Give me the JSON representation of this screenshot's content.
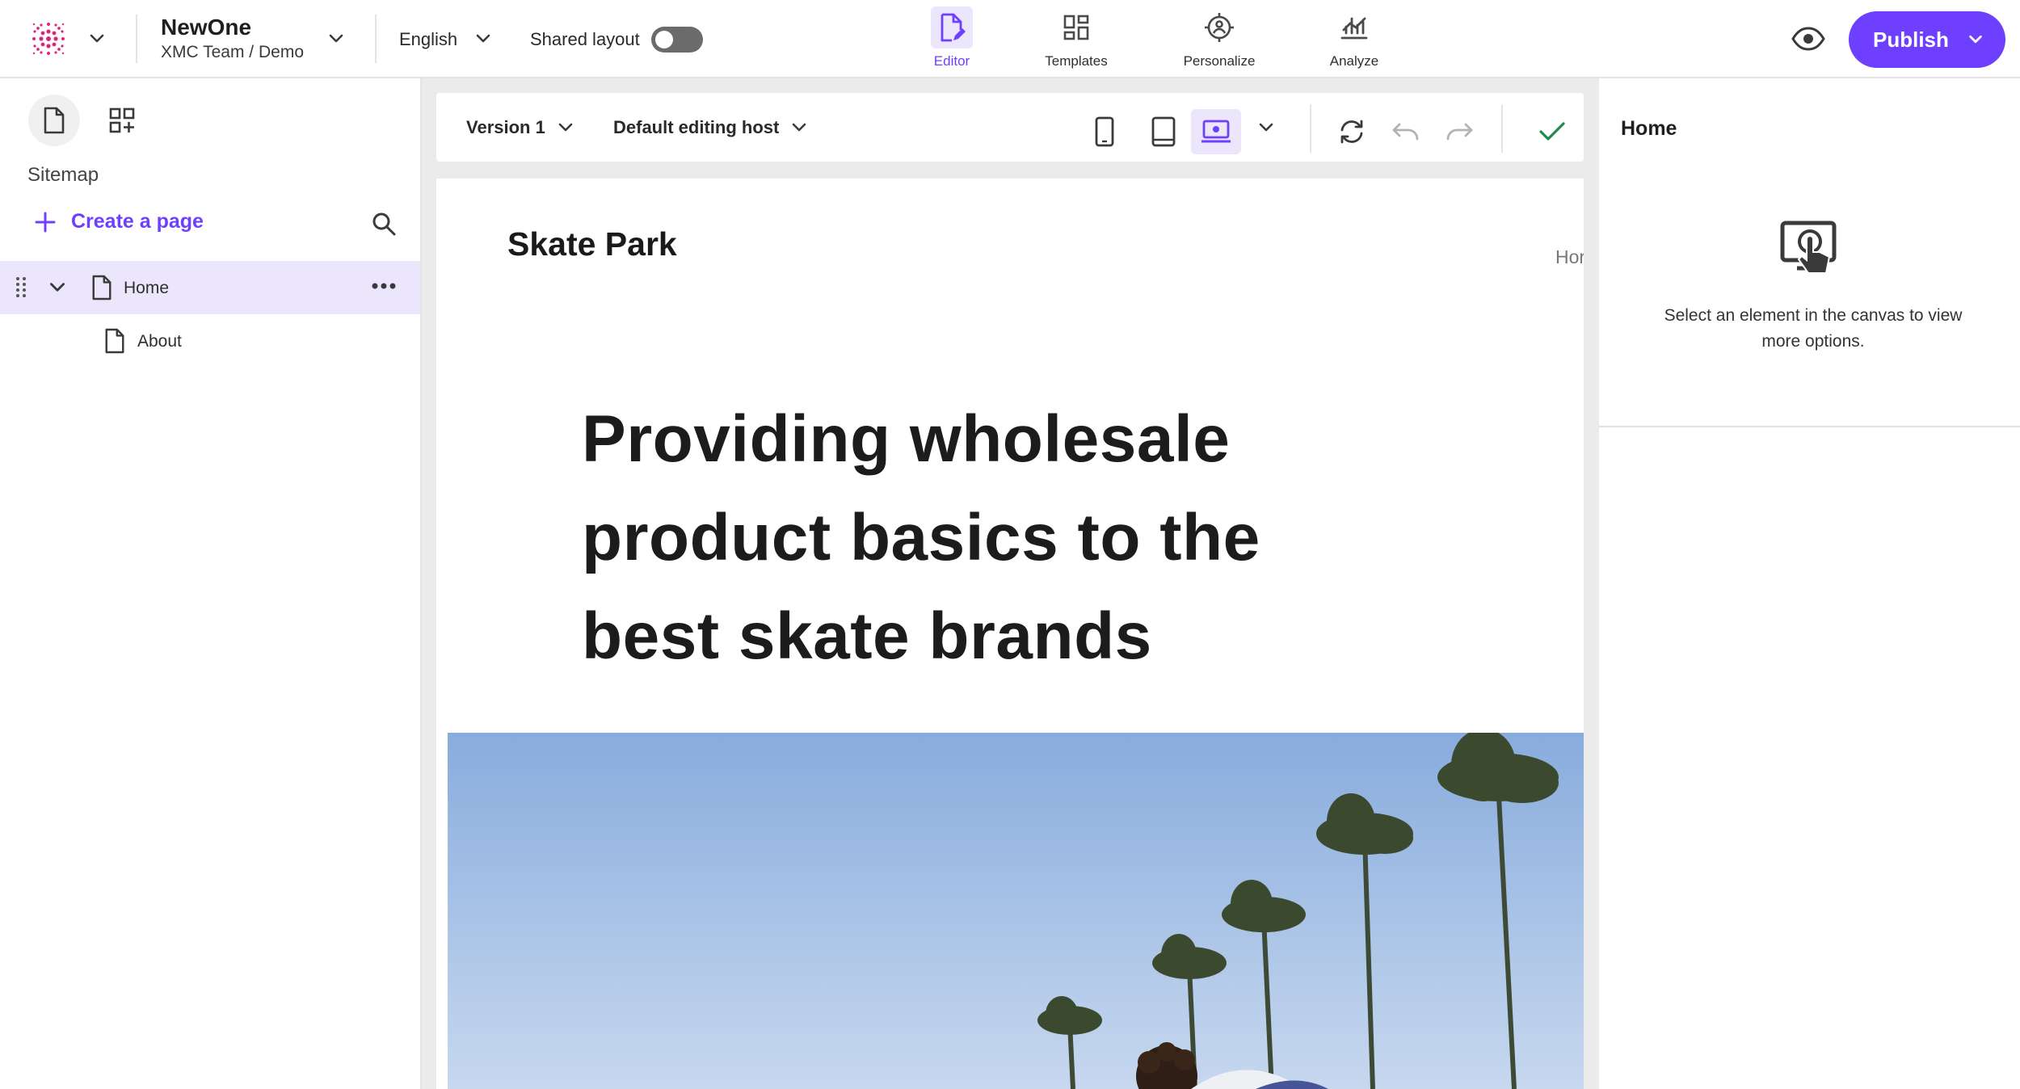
{
  "topbar": {
    "site_name": "NewOne",
    "site_path": "XMC Team / Demo",
    "language": "English",
    "shared_layout_label": "Shared layout",
    "shared_layout_on": false,
    "nav": [
      {
        "label": "Editor",
        "icon": "editor-icon",
        "active": true
      },
      {
        "label": "Templates",
        "icon": "templates-icon",
        "active": false
      },
      {
        "label": "Personalize",
        "icon": "personalize-icon",
        "active": false
      },
      {
        "label": "Analyze",
        "icon": "analyze-icon",
        "active": false
      }
    ],
    "publish_label": "Publish",
    "accent_color": "#6e3fff"
  },
  "sidebar": {
    "title": "Sitemap",
    "create_page_label": "Create a page",
    "tree": [
      {
        "label": "Home",
        "selected": true,
        "expanded": true
      },
      {
        "label": "About",
        "selected": false
      }
    ]
  },
  "canvas": {
    "toolbar": {
      "version_label": "Version 1",
      "host_label": "Default editing host",
      "device_selected": "desktop"
    },
    "page": {
      "site_title": "Skate Park",
      "nav_partial": "Hor",
      "hero_heading": "Providing wholesale product basics to the best skate brands"
    }
  },
  "right_panel": {
    "title": "Home",
    "hint": "Select an element in the canvas to view more options."
  }
}
